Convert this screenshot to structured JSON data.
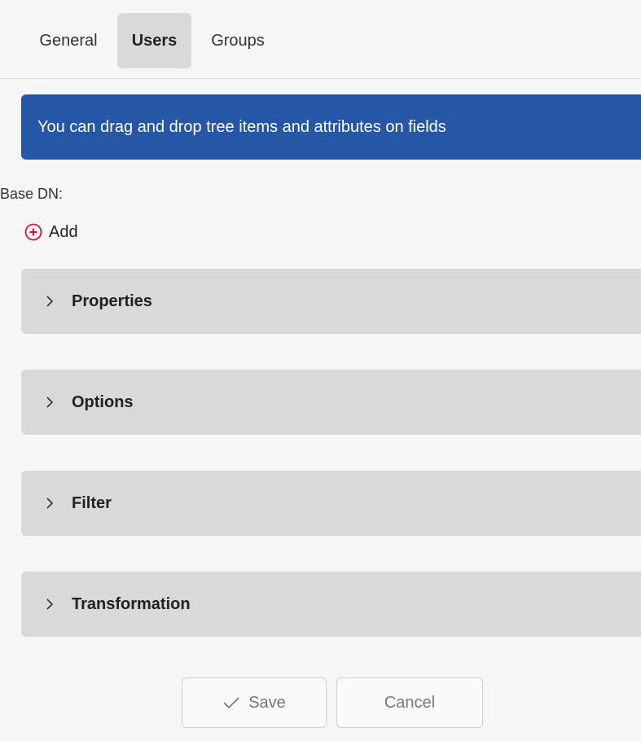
{
  "tabs": [
    {
      "label": "General",
      "active": false
    },
    {
      "label": "Users",
      "active": true
    },
    {
      "label": "Groups",
      "active": false
    }
  ],
  "banner": {
    "text": "You can drag and drop tree items and attributes on fields",
    "color": "#2557a6"
  },
  "base_dn": {
    "label": "Base DN:",
    "add_label": "Add",
    "add_icon": "plus-circle-icon",
    "add_icon_color": "#d6173a"
  },
  "sections": [
    {
      "label": "Properties",
      "icon": "chevron-right-icon",
      "expanded": false
    },
    {
      "label": "Options",
      "icon": "chevron-right-icon",
      "expanded": false
    },
    {
      "label": "Filter",
      "icon": "chevron-right-icon",
      "expanded": false
    },
    {
      "label": "Transformation",
      "icon": "chevron-right-icon",
      "expanded": false
    }
  ],
  "actions": {
    "save_label": "Save",
    "save_icon": "check-icon",
    "cancel_label": "Cancel"
  }
}
